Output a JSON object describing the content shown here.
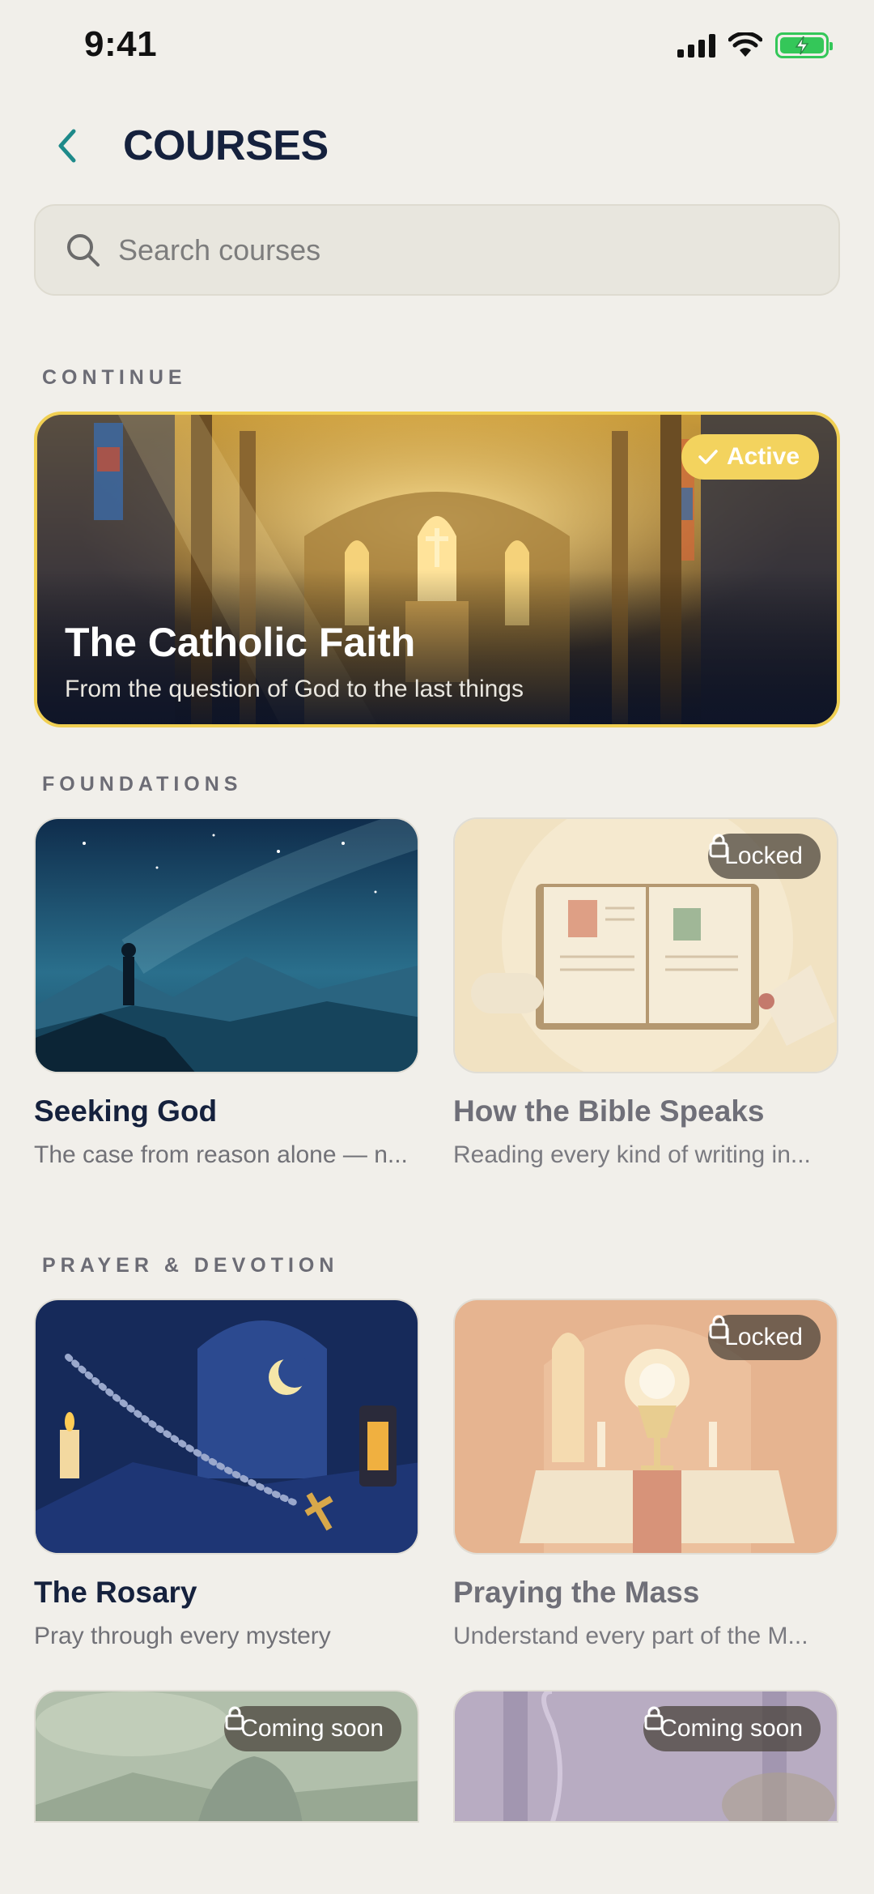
{
  "status_bar": {
    "time": "9:41"
  },
  "header": {
    "title": "COURSES"
  },
  "search": {
    "placeholder": "Search courses"
  },
  "sections": {
    "continue": "CONTINUE",
    "foundations": "FOUNDATIONS",
    "prayer": "PRAYER & DEVOTION"
  },
  "featured": {
    "badge": "Active",
    "title": "The Catholic Faith",
    "subtitle": "From the question of God to the last things"
  },
  "foundations": [
    {
      "title": "Seeking God",
      "subtitle": "The case from reason alone — n...",
      "badge": ""
    },
    {
      "title": "How the Bible Speaks",
      "subtitle": "Reading every kind of writing in...",
      "badge": "Locked"
    }
  ],
  "prayer": [
    {
      "title": "The Rosary",
      "subtitle": "Pray through every mystery",
      "badge": ""
    },
    {
      "title": "Praying the Mass",
      "subtitle": "Understand every part of the M...",
      "badge": "Locked"
    }
  ],
  "upcoming": [
    {
      "badge": "Coming soon"
    },
    {
      "badge": "Coming soon"
    }
  ],
  "colors": {
    "background": "#f1efea",
    "accent_teal": "#1e8a8a",
    "active_gold": "#f3d35e",
    "title_navy": "#15213d"
  }
}
